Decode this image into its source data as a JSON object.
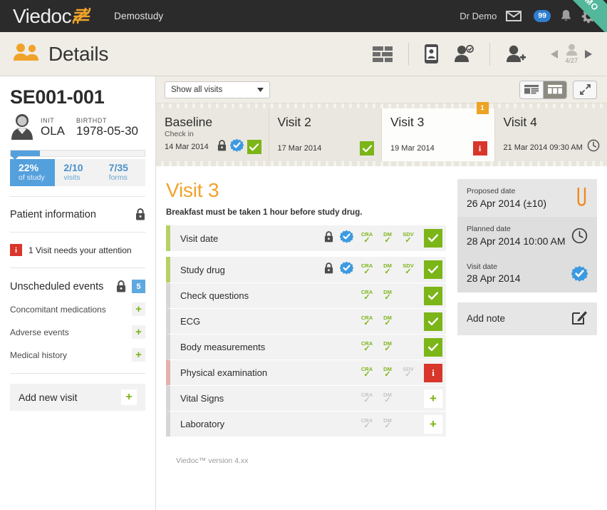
{
  "topbar": {
    "logo_text": "Viedoc",
    "logo_icon": "dna-helix-icon",
    "study_name": "Demostudy",
    "user_name": "Dr Demo",
    "mail_icon": "envelope-icon",
    "message_count": "99",
    "bell_icon": "bell-icon",
    "gear_icon": "gear-icon",
    "ribbon_label": "DEMO"
  },
  "pagebar": {
    "title": "Details",
    "title_icon": "two-people-icon",
    "tools": [
      {
        "name": "grid-view-icon"
      },
      {
        "name": "tablet-device-icon"
      },
      {
        "name": "person-verified-icon"
      },
      {
        "name": "add-person-icon"
      }
    ],
    "nav_prev_icon": "triangle-left-icon",
    "nav_next_icon": "triangle-right-icon",
    "nav_counter": "4/27"
  },
  "sidebar": {
    "subject_id": "SE001-001",
    "avatar_icon": "person-avatar-icon",
    "fields": [
      {
        "label": "INIT",
        "value": "OLA"
      },
      {
        "label": "BIRTHDT",
        "value": "1978-05-30"
      }
    ],
    "progress_percent": 22,
    "stats": [
      {
        "value": "22%",
        "label": "of study",
        "primary": true
      },
      {
        "value": "2/10",
        "label": "visits",
        "primary": false
      },
      {
        "value": "7/35",
        "label": "forms",
        "primary": false
      }
    ],
    "patient_information": {
      "label": "Patient information",
      "icon": "lock-icon"
    },
    "attention": {
      "icon": "info-icon",
      "text": "1 Visit needs your attention"
    },
    "unscheduled": {
      "label": "Unscheduled events",
      "lock_icon": "lock-icon",
      "count": "5"
    },
    "sub_items": [
      {
        "label": "Concomitant medications",
        "action": "+"
      },
      {
        "label": "Adverse events",
        "action": "+"
      },
      {
        "label": "Medical history",
        "action": "+"
      }
    ],
    "add_new_visit": {
      "label": "Add new visit",
      "action": "+"
    }
  },
  "visits_toolbar": {
    "filter_value": "Show all visits",
    "chevron_icon": "chevron-down-icon",
    "view_list_icon": "list-view-icon",
    "view_card_icon": "card-view-icon",
    "active_view": "card",
    "expand_icon": "expand-arrows-icon"
  },
  "visit_cards": [
    {
      "title": "Baseline",
      "subtitle": "Check in",
      "date": "14 Mar 2014",
      "active": false,
      "flag": null,
      "icons": [
        "lock-icon",
        "signed-badge-icon",
        "green-check-icon"
      ]
    },
    {
      "title": "Visit 2",
      "subtitle": "",
      "date": "17 Mar 2014",
      "active": false,
      "flag": null,
      "icons": [
        "green-check-icon"
      ]
    },
    {
      "title": "Visit 3",
      "subtitle": "",
      "date": "19 Mar 2014",
      "active": true,
      "flag": "1",
      "icons": [
        "red-info-icon"
      ]
    },
    {
      "title": "Visit 4",
      "subtitle": "",
      "date": "21 Mar 2014 09:30 AM",
      "active": false,
      "flag": null,
      "icons": [
        "clock-icon"
      ]
    }
  ],
  "visit_detail": {
    "heading": "Visit 3",
    "note": "Breakfast must be taken 1 hour before study drug.",
    "form_groups": [
      {
        "rows": [
          {
            "name": "Visit date",
            "bar": "green",
            "lock": true,
            "signed": true,
            "tags": [
              {
                "label": "CRA",
                "dim": false
              },
              {
                "label": "DM",
                "dim": false
              },
              {
                "label": "SDV",
                "dim": false
              }
            ],
            "status": "check"
          }
        ]
      },
      {
        "rows": [
          {
            "name": "Study drug",
            "bar": "green",
            "lock": true,
            "signed": true,
            "tags": [
              {
                "label": "CRA",
                "dim": false
              },
              {
                "label": "DM",
                "dim": false
              },
              {
                "label": "SDV",
                "dim": false
              }
            ],
            "status": "check"
          },
          {
            "name": "Check questions",
            "bar": "gray",
            "lock": false,
            "signed": false,
            "tags": [
              {
                "label": "CRA",
                "dim": false
              },
              {
                "label": "DM",
                "dim": false
              }
            ],
            "status": "check"
          },
          {
            "name": "ECG",
            "bar": "gray",
            "lock": false,
            "signed": false,
            "tags": [
              {
                "label": "CRA",
                "dim": false
              },
              {
                "label": "DM",
                "dim": false
              }
            ],
            "status": "check"
          },
          {
            "name": "Body measurements",
            "bar": "gray",
            "lock": false,
            "signed": false,
            "tags": [
              {
                "label": "CRA",
                "dim": false
              },
              {
                "label": "DM",
                "dim": false
              }
            ],
            "status": "check"
          },
          {
            "name": "Physical examination",
            "bar": "pink",
            "lock": false,
            "signed": false,
            "tags": [
              {
                "label": "CRA",
                "dim": false
              },
              {
                "label": "DM",
                "dim": false
              },
              {
                "label": "SDV",
                "dim": true
              }
            ],
            "status": "info"
          },
          {
            "name": "Vital Signs",
            "bar": "gray",
            "lock": false,
            "signed": false,
            "tags": [
              {
                "label": "CRA",
                "dim": true
              },
              {
                "label": "DM",
                "dim": true
              }
            ],
            "status": "plus"
          },
          {
            "name": "Laboratory",
            "bar": "gray",
            "lock": false,
            "signed": false,
            "tags": [
              {
                "label": "CRA",
                "dim": true
              },
              {
                "label": "DM",
                "dim": true
              }
            ],
            "status": "plus"
          }
        ]
      }
    ]
  },
  "info_panel": {
    "items": [
      {
        "label": "Proposed date",
        "value": "26 Apr 2014 (±10)",
        "icon": "paperclip-icon"
      },
      {
        "label": "Planned date",
        "value": "28 Apr 2014 10:00 AM",
        "icon": "clock-icon"
      },
      {
        "label": "Visit date",
        "value": "28 Apr 2014",
        "icon": "signed-badge-icon"
      }
    ],
    "add_note": {
      "label": "Add note",
      "icon": "edit-note-icon"
    }
  },
  "footer": {
    "version": "Viedoc™ version 4.xx"
  },
  "colors": {
    "accent_orange": "#f0a32a",
    "green": "#7cb518",
    "red": "#d9362b",
    "blue": "#54a0dd",
    "dark": "#2b2b2b",
    "ribbon": "#53b79c"
  }
}
